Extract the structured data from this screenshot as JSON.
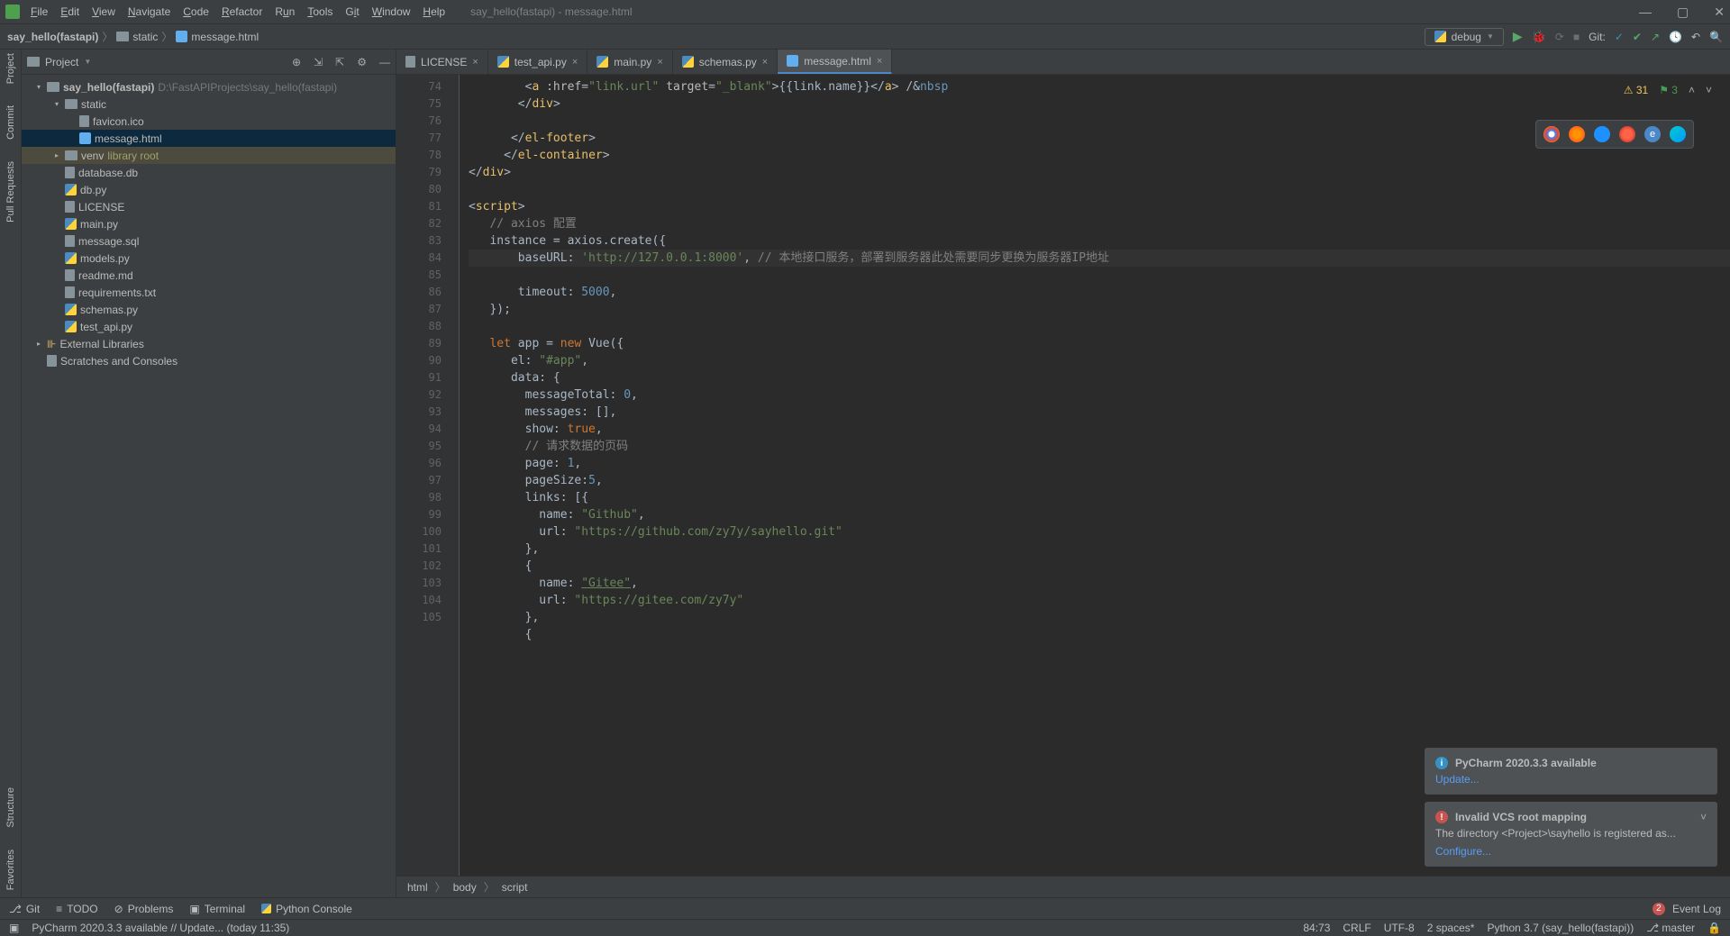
{
  "window_title": "say_hello(fastapi) - message.html",
  "menus": [
    "File",
    "Edit",
    "View",
    "Navigate",
    "Code",
    "Refactor",
    "Run",
    "Tools",
    "Git",
    "Window",
    "Help"
  ],
  "breadcrumb": {
    "root": "say_hello(fastapi)",
    "folder": "static",
    "file": "message.html"
  },
  "run_config": "debug",
  "git_label": "Git:",
  "project_panel": {
    "title": "Project",
    "tree": {
      "root_name": "say_hello(fastapi)",
      "root_path": "D:\\FastAPIProjects\\say_hello(fastapi)",
      "static": "static",
      "favicon": "favicon.ico",
      "message": "message.html",
      "venv": "venv",
      "libroot": "library root",
      "files": [
        "database.db",
        "db.py",
        "LICENSE",
        "main.py",
        "message.sql",
        "models.py",
        "readme.md",
        "requirements.txt",
        "schemas.py",
        "test_api.py"
      ],
      "external": "External Libraries",
      "scratches": "Scratches and Consoles"
    }
  },
  "tabs": [
    {
      "label": "LICENSE",
      "type": "txt"
    },
    {
      "label": "test_api.py",
      "type": "py"
    },
    {
      "label": "main.py",
      "type": "py"
    },
    {
      "label": "schemas.py",
      "type": "py"
    },
    {
      "label": "message.html",
      "type": "html",
      "active": true
    }
  ],
  "inspect": {
    "warn": "31",
    "ok": "3"
  },
  "code_lines": {
    "l74": "        <a :href=\"link.url\" target=\"_blank\">{{link.name}}</a> /&nbsp",
    "l75": "       </div>",
    "l76": "",
    "l77": "      </el-footer>",
    "l78": "     </el-container>",
    "l79": "</div>",
    "l80": "",
    "l81": "<script>",
    "l82": "   // axios 配置",
    "l83": "   instance = axios.create({",
    "l84": "       baseURL: 'http://127.0.0.1:8000', // 本地接口服务，部署到服务器此处需要同步更换为服务器IP地址",
    "l85": "       timeout: 5000,",
    "l86": "   });",
    "l87": "",
    "l88": "   let app = new Vue({",
    "l89": "      el: \"#app\",",
    "l90": "      data: {",
    "l91": "        messageTotal: 0,",
    "l92": "        messages: [],",
    "l93": "        show: true,",
    "l94": "        // 请求数据的页码",
    "l95": "        page: 1,",
    "l96": "        pageSize:5,",
    "l97": "        links: [{",
    "l98": "          name: \"Github\",",
    "l99": "          url: \"https://github.com/zy7y/sayhello.git\"",
    "l100": "        },",
    "l101": "        {",
    "l102": "          name: \"Gitee\",",
    "l103": "          url: \"https://gitee.com/zy7y\"",
    "l104": "        },",
    "l105": "        {"
  },
  "editor_breadcrumb": [
    "html",
    "body",
    "script"
  ],
  "notifications": [
    {
      "type": "info",
      "title": "PyCharm 2020.3.3 available",
      "link": "Update..."
    },
    {
      "type": "error",
      "title": "Invalid VCS root mapping",
      "body": "The directory <Project>\\sayhello is registered as...",
      "link": "Configure..."
    }
  ],
  "bottom_tools": {
    "git": "Git",
    "todo": "TODO",
    "problems": "Problems",
    "terminal": "Terminal",
    "console": "Python Console",
    "event_log": "Event Log",
    "event_count": "2"
  },
  "status": {
    "msg": "PyCharm 2020.3.3 available // Update... (today 11:35)",
    "pos": "84:73",
    "eol": "CRLF",
    "enc": "UTF-8",
    "indent": "2 spaces*",
    "interp": "Python 3.7 (say_hello(fastapi))",
    "branch": "master"
  },
  "left_tools": [
    "Project",
    "Commit",
    "Pull Requests",
    "Structure",
    "Favorites"
  ]
}
